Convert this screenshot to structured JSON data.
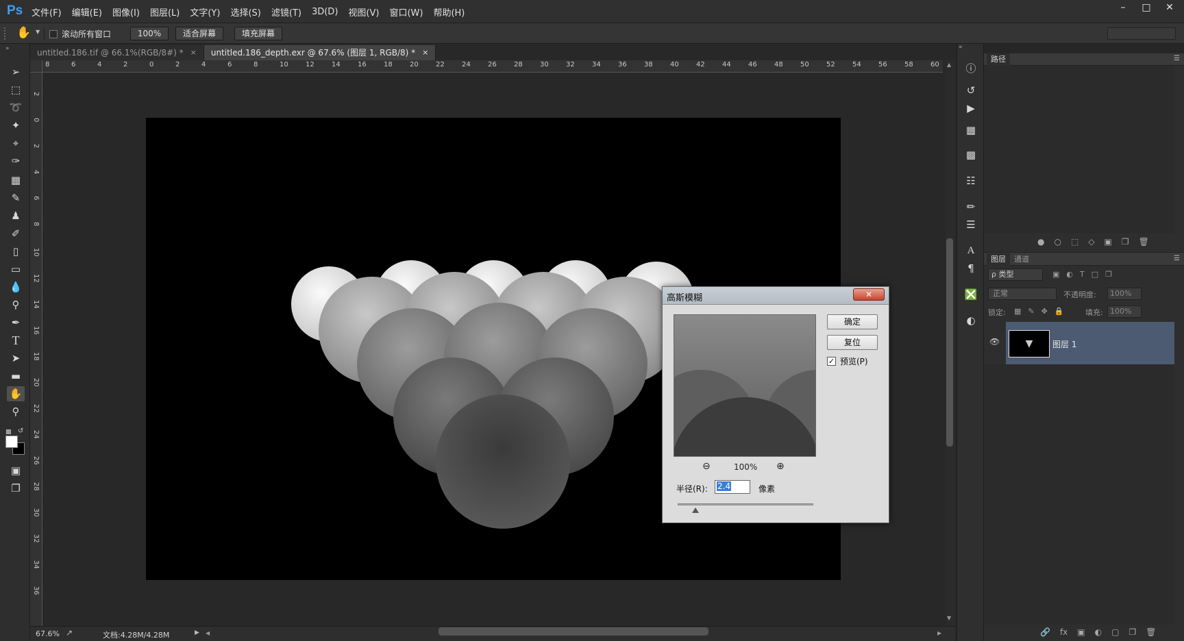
{
  "app": {
    "logo": "Ps"
  },
  "menu": [
    "文件(F)",
    "编辑(E)",
    "图像(I)",
    "图层(L)",
    "文字(Y)",
    "选择(S)",
    "滤镜(T)",
    "3D(D)",
    "视图(V)",
    "窗口(W)",
    "帮助(H)"
  ],
  "options": {
    "scroll_all_label": "滚动所有窗口",
    "zoom_btn": "100%",
    "fit_btn": "适合屏幕",
    "fill_btn": "填充屏幕"
  },
  "tabs": [
    {
      "label": "untitled.186.tif @ 66.1%(RGB/8#) *",
      "close": "×"
    },
    {
      "label": "untitled.186_depth.exr @ 67.6% (图层 1, RGB/8) *",
      "close": "×"
    }
  ],
  "ruler": {
    "h_ticks": [
      "8",
      "6",
      "4",
      "2",
      "0",
      "2",
      "4",
      "6",
      "8",
      "10",
      "12",
      "14",
      "16",
      "18",
      "20",
      "22",
      "24",
      "26",
      "28",
      "30",
      "32",
      "34",
      "36",
      "38",
      "40",
      "42",
      "44",
      "46",
      "48",
      "50",
      "52",
      "54",
      "56",
      "58",
      "60"
    ],
    "v_ticks": [
      "2",
      "0",
      "2",
      "4",
      "6",
      "8",
      "10",
      "12",
      "14",
      "16",
      "18",
      "20",
      "22",
      "24",
      "26",
      "28",
      "30",
      "32",
      "34",
      "36"
    ]
  },
  "status": {
    "zoom": "67.6%",
    "doc": "文档:4.28M/4.28M"
  },
  "paths_panel": {
    "title": "路径"
  },
  "layers_panel": {
    "tabs": [
      "图层",
      "通道"
    ],
    "filter": "ρ 类型",
    "blend_mode": "正常",
    "opacity_label": "不透明度:",
    "opacity_value": "100%",
    "lock_label": "锁定:",
    "fill_label": "填充:",
    "fill_value": "100%",
    "layers": [
      {
        "name": "图层 1",
        "visible": true
      }
    ]
  },
  "dialog": {
    "title": "高斯模糊",
    "ok": "确定",
    "reset": "复位",
    "preview_label": "预览(P)",
    "preview_checked": true,
    "zoom_value": "100%",
    "radius_label": "半径(R):",
    "radius_value": "2.4",
    "unit": "像素",
    "slider_fraction": 0.13
  },
  "colors": {
    "bg": "#282828",
    "panel": "#2e2e2e",
    "layer_selected": "#4c5a72",
    "accent": "#3fa0f0"
  }
}
